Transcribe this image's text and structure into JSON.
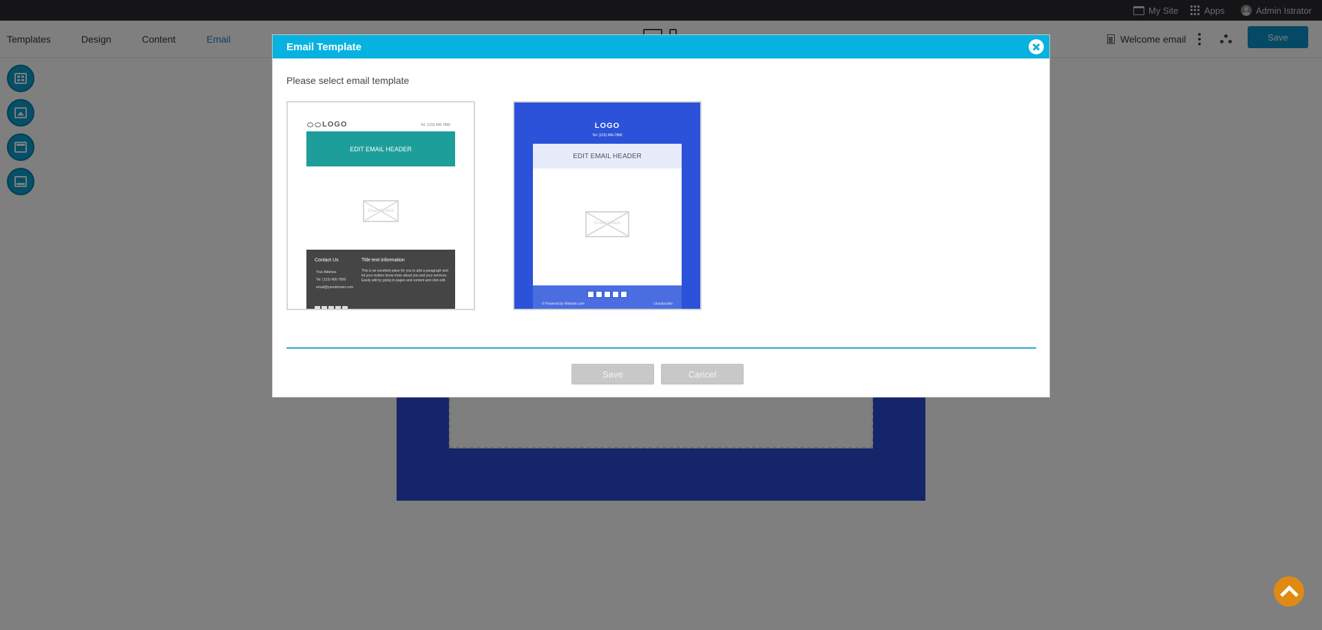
{
  "topbar": {
    "my_site": "My Site",
    "apps": "Apps",
    "user": "Admin Istrator"
  },
  "toolbar": {
    "tabs": [
      {
        "label": "Templates",
        "active": false
      },
      {
        "label": "Design",
        "active": false
      },
      {
        "label": "Content",
        "active": false
      },
      {
        "label": "Email",
        "active": true
      }
    ],
    "document_title": "Welcome email",
    "save_label": "Save",
    "accent_color": "#0a93c9"
  },
  "side_tools": [
    {
      "icon": "layout-grid-icon"
    },
    {
      "icon": "image-block-icon"
    },
    {
      "icon": "header-block-icon"
    },
    {
      "icon": "footer-block-icon"
    }
  ],
  "modal": {
    "title": "Email Template",
    "prompt": "Please select email template",
    "header_color": "#08b2e0",
    "templates": [
      {
        "logo": "LOGO",
        "phone": "Tel: (123) 456-7890",
        "header_text": "EDIT EMAIL HEADER",
        "header_color": "#1e9e9a",
        "content_placeholder": "Email Content",
        "footer": {
          "contact_title": "Contact Us",
          "address_lines": [
            "Your Address",
            "Tel: (123) 456-7890",
            "email@yourdomain.com"
          ],
          "info_title": "Title text information",
          "info_text": "This is an excellent place for you to add a paragraph and let your visitors know more about you and your services. Easily edit by going to pages and content and click edit."
        }
      },
      {
        "logo": "LOGO",
        "phone": "Tel: (123) 456-7890",
        "header_text": "EDIT EMAIL HEADER",
        "background_color": "#2c52d9",
        "content_placeholder": "Email Content",
        "footer_left": "© Powered by Website.com",
        "footer_right": "Unsubscribe"
      }
    ],
    "save_label": "Save",
    "cancel_label": "Cancel"
  }
}
